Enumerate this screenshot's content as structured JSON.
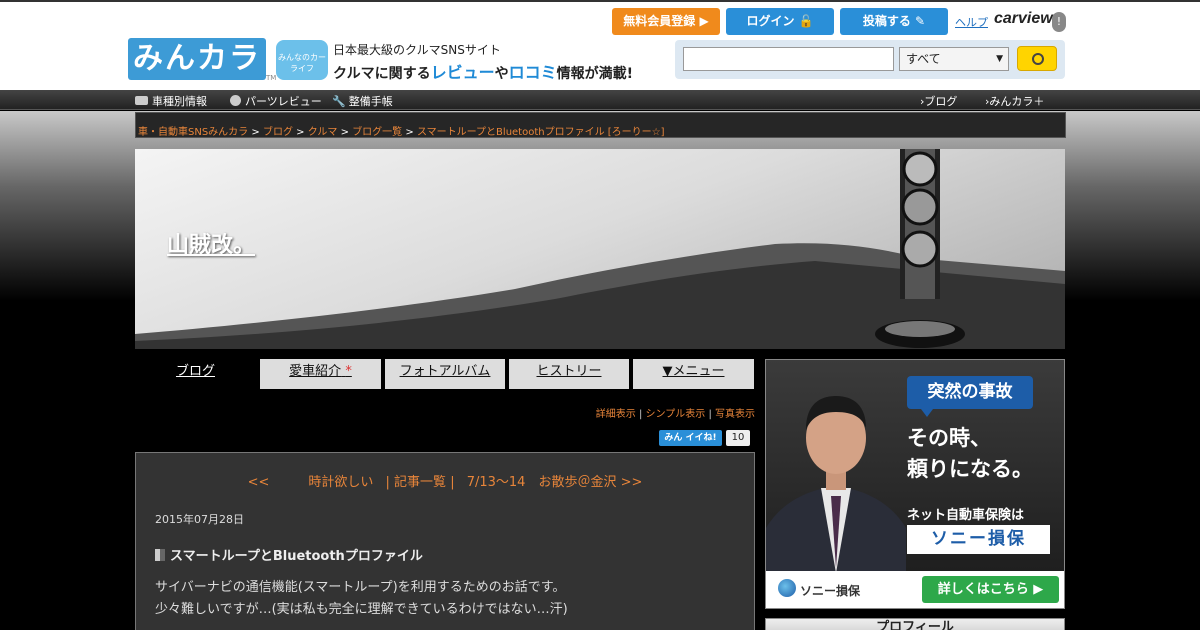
{
  "header": {
    "logo_text": "みんカラ",
    "logo_tm": "TM",
    "car_badge": "みんなのカーライフ",
    "tagline1": "日本最大級のクルマSNSサイト",
    "tagline2_a": "クルマに関する",
    "tagline2_b": "レビュー",
    "tagline2_c": "や",
    "tagline2_d": "ロコミ",
    "tagline2_e": "情報が満載!",
    "buttons": {
      "register": "無料会員登録 ▶",
      "login": "ログイン 🔓",
      "post": "投稿する ✎"
    },
    "help": "ヘルプ",
    "carview": "carview",
    "carview_mark": "!",
    "search": {
      "input_value": "",
      "select_value": "すべて",
      "select_arrow": "▼"
    }
  },
  "global_nav": {
    "left": [
      "車種別情報",
      "パーツレビュー",
      "整備手帳"
    ],
    "right": [
      "ブログ",
      "みんカラ＋"
    ],
    "right_prefix": "›"
  },
  "breadcrumb": {
    "items": [
      "車・自動車SNSみんカラ",
      "ブログ",
      "クルマ",
      "ブログ一覧",
      "スマートループとBluetoothプロファイル [ろーりー☆]"
    ],
    "sep": ">"
  },
  "blog": {
    "title": "山賊改。"
  },
  "tabs": [
    {
      "label": "ブログ"
    },
    {
      "label": "愛車紹介",
      "mark": "*"
    },
    {
      "label": "フォトアルバム"
    },
    {
      "label": "ヒストリー"
    },
    {
      "label": "▼メニュー"
    }
  ],
  "view_options": {
    "detail": "詳細表示",
    "simple": "シンプル表示",
    "photo": "写真表示",
    "sep": "|"
  },
  "iine": {
    "label": "みん イイね!",
    "count": "10"
  },
  "post": {
    "prev": "<<　　　時計欲しい",
    "list": "| 記事一覧 |",
    "next": "7/13～14　お散歩＠金沢 >>",
    "date": "2015年07月28日",
    "title": "スマートループとBluetoothプロファイル",
    "body_line1": "サイバーナビの通信機能(スマートループ)を利用するためのお話です。",
    "body_line2": "少々難しいですが…(実は私も完全に理解できているわけではない…汗)"
  },
  "ad": {
    "bubble": "突然の事故",
    "main_line1": "その時、",
    "main_line2": "頼りになる。",
    "sub": "ネット自動車保険は",
    "brand_box": "ソニー損保",
    "logo_text": "ソニー損保",
    "cta": "詳しくはこちら ▶"
  },
  "profile": {
    "label": "プロフィール"
  }
}
